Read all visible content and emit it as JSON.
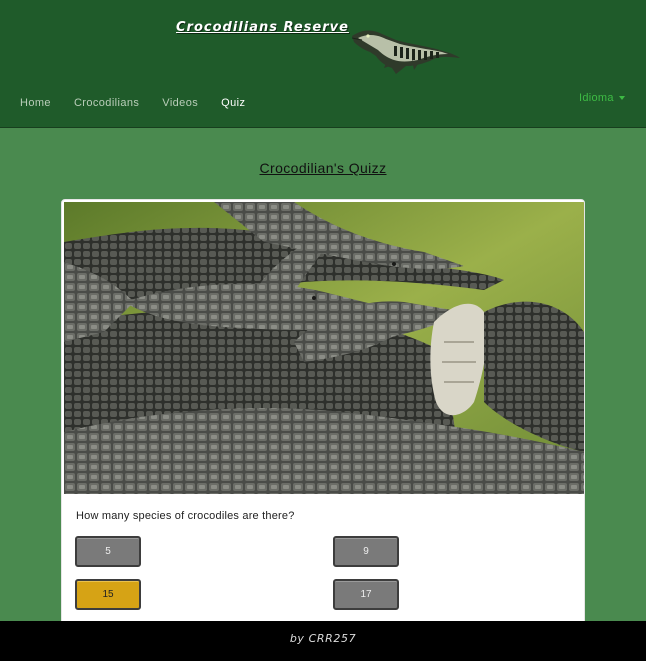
{
  "header": {
    "brand": "Crocodilians Reserve",
    "logo_icon": "crocodile-logo-icon",
    "nav": [
      {
        "label": "Home"
      },
      {
        "label": "Crocodilians"
      },
      {
        "label": "Videos"
      },
      {
        "label": "Quiz",
        "active": true
      }
    ],
    "language_label": "Idioma"
  },
  "main": {
    "title": "Crocodilian's Quizz",
    "image_alt": "Group of crocodiles",
    "question": "How many species of crocodiles are there?",
    "answers": [
      {
        "label": "5"
      },
      {
        "label": "9"
      },
      {
        "label": "15",
        "selected": true
      },
      {
        "label": "17"
      }
    ]
  },
  "footer": {
    "text": "by CRR257"
  },
  "colors": {
    "header_bg": "#1f5b2a",
    "page_bg": "#4a8a4f",
    "selected_answer": "#d6a315",
    "language_link": "#3dbb44"
  }
}
